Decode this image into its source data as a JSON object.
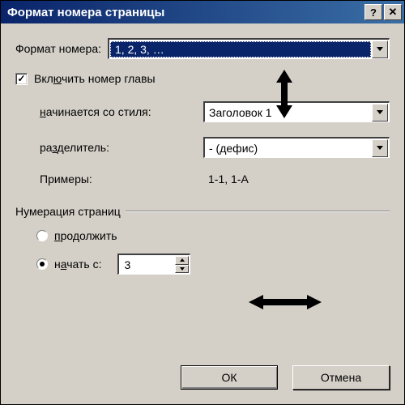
{
  "titlebar": {
    "title": "Формат номера страницы",
    "help_icon": "?",
    "close_icon": "✕"
  },
  "format_row": {
    "label": "Формат номера:",
    "value": "1, 2, 3, …"
  },
  "include_chapter": {
    "label_pre": "Вкл",
    "label_u": "ю",
    "label_post": "чить номер главы"
  },
  "starts_with_style": {
    "label_u": "н",
    "label_post": "ачинается со стиля:",
    "value": "Заголовок 1"
  },
  "separator": {
    "label_pre": "ра",
    "label_u": "з",
    "label_post": "делитель:",
    "value": "-   (дефис)"
  },
  "examples": {
    "label": "Примеры:",
    "value": "1-1, 1-A"
  },
  "numbering_group": {
    "label": "Нумерация страниц",
    "continue": {
      "label_u": "п",
      "label_post": "родолжить"
    },
    "start_from": {
      "label_pre": "н",
      "label_u": "а",
      "label_post": "чать с:",
      "value": "3"
    }
  },
  "buttons": {
    "ok": "ОК",
    "cancel": "Отмена"
  }
}
